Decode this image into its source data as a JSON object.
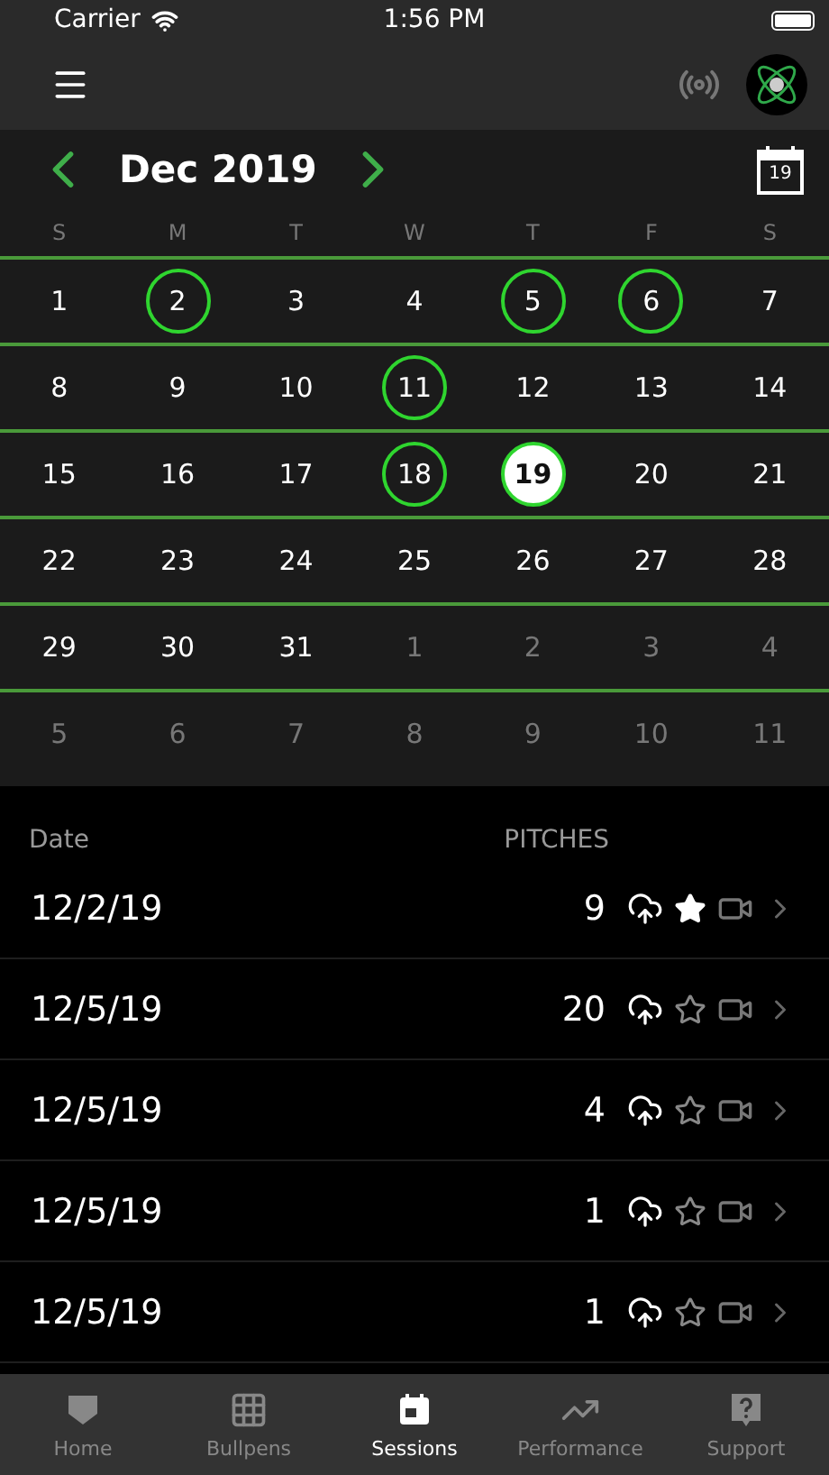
{
  "status_bar": {
    "carrier": "Carrier",
    "time": "1:56 PM"
  },
  "calendar": {
    "month": "Dec 2019",
    "today_badge": "19",
    "weekdays": [
      "S",
      "M",
      "T",
      "W",
      "T",
      "F",
      "S"
    ],
    "weeks": [
      [
        {
          "day": "1",
          "in_month": true,
          "has_session": false,
          "selected": false
        },
        {
          "day": "2",
          "in_month": true,
          "has_session": true,
          "selected": false
        },
        {
          "day": "3",
          "in_month": true,
          "has_session": false,
          "selected": false
        },
        {
          "day": "4",
          "in_month": true,
          "has_session": false,
          "selected": false
        },
        {
          "day": "5",
          "in_month": true,
          "has_session": true,
          "selected": false
        },
        {
          "day": "6",
          "in_month": true,
          "has_session": true,
          "selected": false
        },
        {
          "day": "7",
          "in_month": true,
          "has_session": false,
          "selected": false
        }
      ],
      [
        {
          "day": "8",
          "in_month": true,
          "has_session": false,
          "selected": false
        },
        {
          "day": "9",
          "in_month": true,
          "has_session": false,
          "selected": false
        },
        {
          "day": "10",
          "in_month": true,
          "has_session": false,
          "selected": false
        },
        {
          "day": "11",
          "in_month": true,
          "has_session": true,
          "selected": false
        },
        {
          "day": "12",
          "in_month": true,
          "has_session": false,
          "selected": false
        },
        {
          "day": "13",
          "in_month": true,
          "has_session": false,
          "selected": false
        },
        {
          "day": "14",
          "in_month": true,
          "has_session": false,
          "selected": false
        }
      ],
      [
        {
          "day": "15",
          "in_month": true,
          "has_session": false,
          "selected": false
        },
        {
          "day": "16",
          "in_month": true,
          "has_session": false,
          "selected": false
        },
        {
          "day": "17",
          "in_month": true,
          "has_session": false,
          "selected": false
        },
        {
          "day": "18",
          "in_month": true,
          "has_session": true,
          "selected": false
        },
        {
          "day": "19",
          "in_month": true,
          "has_session": true,
          "selected": true
        },
        {
          "day": "20",
          "in_month": true,
          "has_session": false,
          "selected": false
        },
        {
          "day": "21",
          "in_month": true,
          "has_session": false,
          "selected": false
        }
      ],
      [
        {
          "day": "22",
          "in_month": true,
          "has_session": false,
          "selected": false
        },
        {
          "day": "23",
          "in_month": true,
          "has_session": false,
          "selected": false
        },
        {
          "day": "24",
          "in_month": true,
          "has_session": false,
          "selected": false
        },
        {
          "day": "25",
          "in_month": true,
          "has_session": false,
          "selected": false
        },
        {
          "day": "26",
          "in_month": true,
          "has_session": false,
          "selected": false
        },
        {
          "day": "27",
          "in_month": true,
          "has_session": false,
          "selected": false
        },
        {
          "day": "28",
          "in_month": true,
          "has_session": false,
          "selected": false
        }
      ],
      [
        {
          "day": "29",
          "in_month": true,
          "has_session": false,
          "selected": false
        },
        {
          "day": "30",
          "in_month": true,
          "has_session": false,
          "selected": false
        },
        {
          "day": "31",
          "in_month": true,
          "has_session": false,
          "selected": false
        },
        {
          "day": "1",
          "in_month": false,
          "has_session": false,
          "selected": false
        },
        {
          "day": "2",
          "in_month": false,
          "has_session": false,
          "selected": false
        },
        {
          "day": "3",
          "in_month": false,
          "has_session": false,
          "selected": false
        },
        {
          "day": "4",
          "in_month": false,
          "has_session": false,
          "selected": false
        }
      ],
      [
        {
          "day": "5",
          "in_month": false,
          "has_session": false,
          "selected": false
        },
        {
          "day": "6",
          "in_month": false,
          "has_session": false,
          "selected": false
        },
        {
          "day": "7",
          "in_month": false,
          "has_session": false,
          "selected": false
        },
        {
          "day": "8",
          "in_month": false,
          "has_session": false,
          "selected": false
        },
        {
          "day": "9",
          "in_month": false,
          "has_session": false,
          "selected": false
        },
        {
          "day": "10",
          "in_month": false,
          "has_session": false,
          "selected": false
        },
        {
          "day": "11",
          "in_month": false,
          "has_session": false,
          "selected": false
        }
      ]
    ]
  },
  "sessions": {
    "columns": [
      "Date",
      "PITCHES"
    ],
    "rows": [
      {
        "date": "12/2/19",
        "pitches": "9",
        "starred": true
      },
      {
        "date": "12/5/19",
        "pitches": "20",
        "starred": false
      },
      {
        "date": "12/5/19",
        "pitches": "4",
        "starred": false
      },
      {
        "date": "12/5/19",
        "pitches": "1",
        "starred": false
      },
      {
        "date": "12/5/19",
        "pitches": "1",
        "starred": false
      }
    ]
  },
  "tab_bar": [
    {
      "kind": "home",
      "label": "Home",
      "selected": false
    },
    {
      "kind": "bullpens",
      "label": "Bullpens",
      "selected": false
    },
    {
      "kind": "sessions",
      "label": "Sessions",
      "selected": true
    },
    {
      "kind": "performance",
      "label": "Performance",
      "selected": false
    },
    {
      "kind": "support",
      "label": "Support",
      "selected": false
    }
  ]
}
